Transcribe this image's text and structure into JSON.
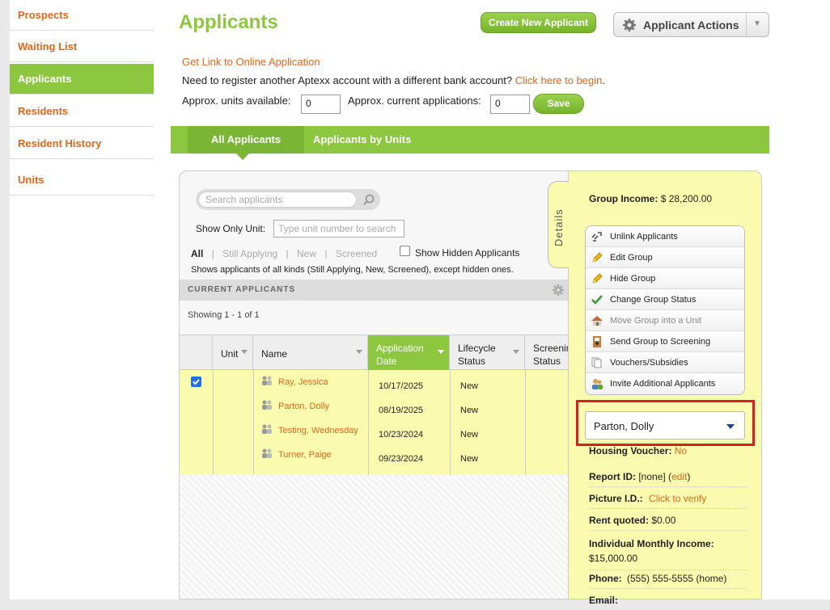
{
  "sidebar": {
    "items": [
      {
        "label": "Prospects"
      },
      {
        "label": "Waiting List"
      },
      {
        "label": "Applicants"
      },
      {
        "label": "Residents"
      },
      {
        "label": "Resident History"
      },
      {
        "label": "Units"
      }
    ]
  },
  "header": {
    "title": "Applicants",
    "create_button": "Create New Applicant",
    "actions_button": "Applicant Actions"
  },
  "links": {
    "get_link": "Get Link to Online Application",
    "register_text": "Need to register another Aptexx account with a different bank account?",
    "register_link": "Click here to begin",
    "register_end": "."
  },
  "units_form": {
    "units_label": "Approx. units available:",
    "units_value": "0",
    "apps_label": "Approx. current applications:",
    "apps_value": "0",
    "save_label": "Save"
  },
  "tabs": [
    {
      "label": "All Applicants",
      "active": true
    },
    {
      "label": "Applicants by Units",
      "active": false
    }
  ],
  "list": {
    "search_placeholder": "Search applicants",
    "show_only_label": "Show Only Unit:",
    "unit_placeholder": "Type unit number to search",
    "filters": [
      "All",
      "Still Applying",
      "New",
      "Screened"
    ],
    "filter_sep": "|",
    "show_hidden_label": "Show Hidden Applicants",
    "filter_description": "Shows applicants of all kinds (Still Applying, New, Screened), except hidden ones.",
    "section_title": "CURRENT APPLICANTS",
    "showing": "Showing 1 - 1 of 1",
    "columns": [
      "Unit",
      "Name",
      "Application Date",
      "Lifecycle Status",
      "Screening Status"
    ],
    "rows": [
      {
        "name": "Ray, Jessica",
        "date": "10/17/2025",
        "status": "New"
      },
      {
        "name": "Parton, Dolly",
        "date": "08/19/2025",
        "status": "New"
      },
      {
        "name": "Testing, Wednesday",
        "date": "10/23/2024",
        "status": "New"
      },
      {
        "name": "Turner, Paige",
        "date": "09/23/2024",
        "status": "New"
      }
    ]
  },
  "details": {
    "tab_label": "Details",
    "group_income_label": "Group Income:",
    "group_income_value": "$ 28,200.00",
    "menu": [
      {
        "label": "Unlink Applicants",
        "icon": "unlink-icon"
      },
      {
        "label": "Edit Group",
        "icon": "pencil-icon"
      },
      {
        "label": "Hide Group",
        "icon": "pencil-icon"
      },
      {
        "label": "Change Group Status",
        "icon": "checkmark-icon"
      },
      {
        "label": "Move Group into a Unit",
        "icon": "house-icon"
      },
      {
        "label": "Send Group to Screening",
        "icon": "screening-icon"
      },
      {
        "label": "Vouchers/Subsidies",
        "icon": "documents-icon"
      },
      {
        "label": "Invite Additional Applicants",
        "icon": "add-people-icon"
      }
    ],
    "selected_applicant": "Parton, Dolly",
    "housing_voucher_label": "Housing Voucher:",
    "housing_voucher_value": "No",
    "report_id_label": "Report ID:",
    "report_id_value": "[none]",
    "report_id_edit": "edit",
    "picture_id_label": "Picture I.D.:",
    "picture_id_value": "Click to verify",
    "rent_label": "Rent quoted:",
    "rent_value": "$0.00",
    "income_label": "Individual Monthly Income:",
    "income_value": "$15,000.00",
    "phone_label": "Phone:",
    "phone_value": "(555) 555-5555 (home)",
    "email_label": "Email:"
  },
  "colors": {
    "brand_green": "#8dc63f",
    "link_orange": "#e2661b",
    "highlight_red": "#d71f1f",
    "row_yellow": "#fbfbb0"
  }
}
